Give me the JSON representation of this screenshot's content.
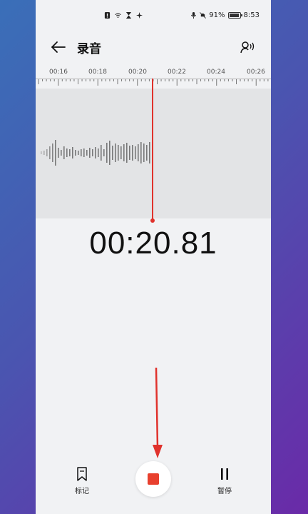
{
  "status_bar": {
    "battery_percent": "91%",
    "time": "8:53",
    "icons": [
      "alert-icon",
      "wifi-icon",
      "hourglass-icon",
      "sparkle-icon",
      "mic-icon",
      "bell-off-icon",
      "battery-icon"
    ]
  },
  "header": {
    "title": "录音",
    "back_icon": "arrow-left-icon",
    "voice_icon": "voice-wave-icon"
  },
  "timeline": {
    "ticks": [
      "00:16",
      "00:18",
      "00:20",
      "00:22",
      "00:24",
      "00:26"
    ]
  },
  "timer": "00:20.81",
  "controls": {
    "mark_label": "标记",
    "pause_label": "暂停",
    "stop_icon": "stop-icon"
  },
  "colors": {
    "accent_red": "#e0322c",
    "stop_red": "#e8402e",
    "panel_bg": "#f1f2f4"
  }
}
